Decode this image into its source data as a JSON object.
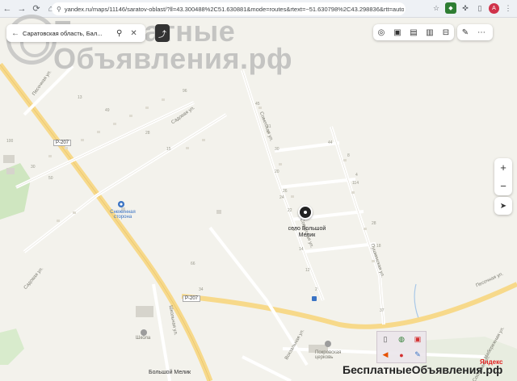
{
  "browser": {
    "url": "yandex.ru/maps/11146/saratov-oblast/?ll=43.300488%2C51.630881&mode=routes&rtext=~51.630798%2C43.298836&rtt=auto&ruri..."
  },
  "search": {
    "value": "Саратовская область, Бал..."
  },
  "watermark": {
    "line1": "Бесплатные",
    "line2": "Объявления.рф",
    "bottom": "БесплатныеОбъявления.рф"
  },
  "pin": {
    "line1": "село Большой",
    "line2": "Мелик"
  },
  "map_labels": {
    "road_r207_a": "Р-207",
    "road_r207_b": "Р-207",
    "sadovaya": "Садовая ул.",
    "sovetskaya": "Советская ул.",
    "pushkinskaya": "Пушкинская ул.",
    "proletarskaya": "Пролетарская ул.",
    "pesochnaya": "Песочная ул.",
    "shkolnaya": "Школьная ул.",
    "sadovaya_w": "Садовая ул.",
    "pesoch_nw": "Песочная ул.",
    "vokzalnaya": "Вокзальная ул.",
    "naberezhnaya": "Набережная ул.",
    "poselok": "Сосновая ул.",
    "gas": "Снежинная сторона",
    "school": "Школа",
    "church": "Покровская церковь",
    "settlement": "Большой Мелик"
  },
  "house_numbers": [
    "45",
    "41",
    "30",
    "20",
    "26",
    "22",
    "24",
    "16",
    "14",
    "12",
    "2",
    "8",
    "4",
    "114",
    "28",
    "15",
    "50",
    "66",
    "37",
    "34",
    "100",
    "30",
    "13",
    "49",
    "96",
    "44",
    "28",
    "18"
  ],
  "yandex": "Яндекс",
  "colors": {
    "map_bg": "#f3f2ec",
    "road_major": "#f7d98a",
    "road_minor": "#ffffff",
    "green": "#cfe6c0",
    "water": "#a8c8e8",
    "building": "#d6d4cc"
  }
}
